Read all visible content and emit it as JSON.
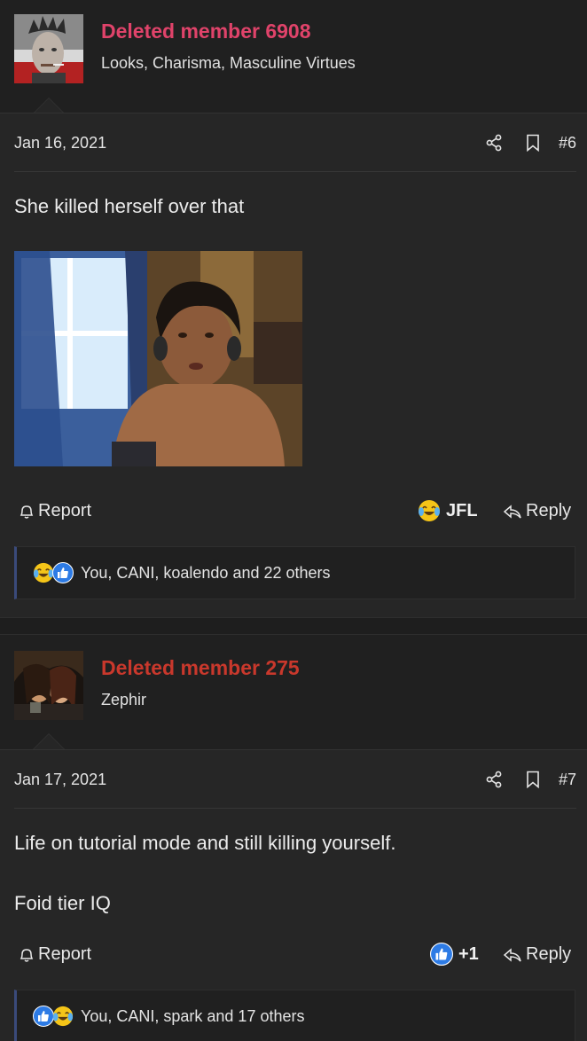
{
  "posts": [
    {
      "username": "Deleted member 6908",
      "username_color": "#e0436a",
      "user_title": "Looks, Charisma, Masculine Virtues",
      "date": "Jan 16, 2021",
      "post_number": "#6",
      "text_lines": [
        "She killed herself over that"
      ],
      "has_image": true,
      "report_label": "Report",
      "reaction_label": "JFL",
      "reaction_icon": "crying-laughing-emoji",
      "reply_label": "Reply",
      "reactions_summary": "You, CANI, koalendo and 22 others",
      "reaction_icons": [
        "crying-laughing-emoji",
        "thumbs-up-icon"
      ]
    },
    {
      "username": "Deleted member 275",
      "username_color": "#c9382c",
      "user_title": "Zephir",
      "date": "Jan 17, 2021",
      "post_number": "#7",
      "text_lines": [
        "Life on tutorial mode and still killing yourself.",
        "Foid tier IQ"
      ],
      "has_image": false,
      "report_label": "Report",
      "reaction_label": "+1",
      "reaction_icon": "thumbs-up-icon",
      "reply_label": "Reply",
      "reactions_summary": "You, CANI, spark and 17 others",
      "reaction_icons": [
        "thumbs-up-icon",
        "crying-laughing-emoji"
      ]
    }
  ],
  "colors": {
    "background": "#202020",
    "message_bg": "#262626",
    "reaction_bar_accent": "#3a4a7a",
    "like_blue": "#2d7be5",
    "laugh_yellow": "#f5c518"
  }
}
